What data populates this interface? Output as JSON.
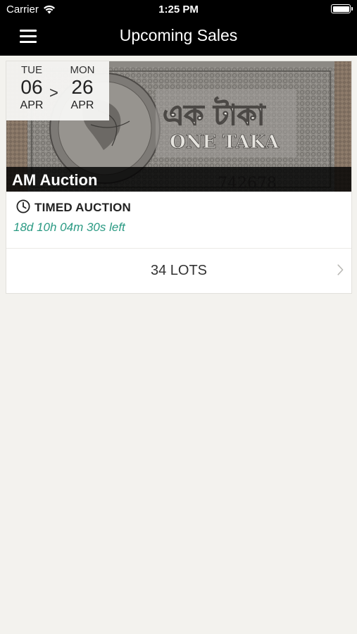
{
  "status_bar": {
    "carrier": "Carrier",
    "time": "1:25 PM"
  },
  "nav": {
    "title": "Upcoming Sales",
    "menu_icon": "hamburger-menu-icon"
  },
  "sale": {
    "banner_image": "one-taka-banknote",
    "start": {
      "day": "TUE",
      "date": "06",
      "month": "APR"
    },
    "separator": ">",
    "end": {
      "day": "MON",
      "date": "26",
      "month": "APR"
    },
    "name": "AM Auction",
    "type": "TIMED AUCTION",
    "time_left": "18d 10h 04m 30s left",
    "lots": "34 LOTS"
  },
  "colors": {
    "nav_background": "#000000",
    "page_background": "#f3f2ee",
    "countdown": "#2a9a83"
  },
  "banner_text": {
    "bengali": "এক টাকা",
    "english": "ONE TAKA",
    "serial": "742678"
  }
}
